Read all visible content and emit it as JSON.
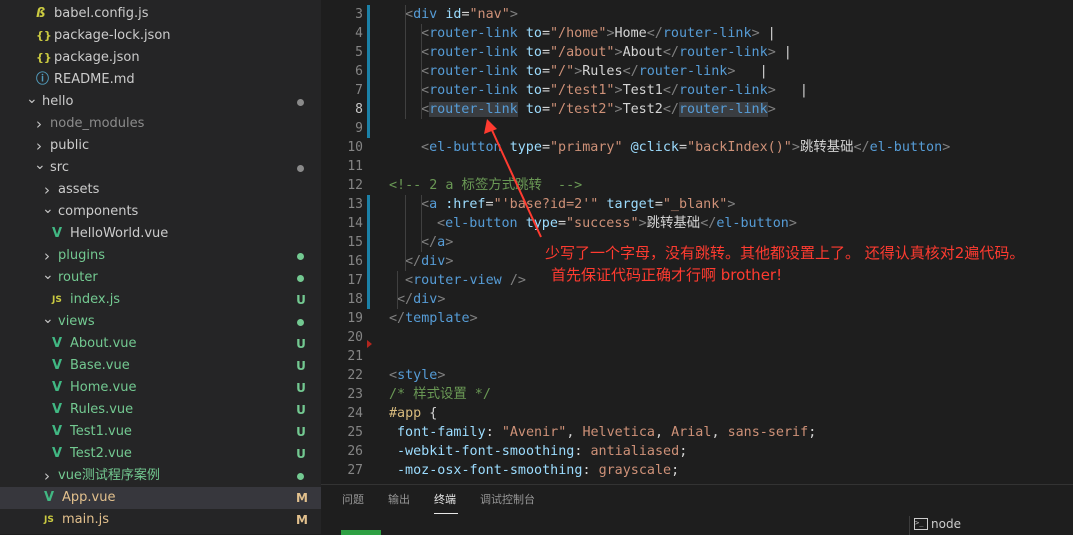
{
  "explorer": {
    "items": [
      {
        "label": "babel.config.js",
        "icon": "babel-file-icon",
        "icon_text": "",
        "depth": 1,
        "chevron": "",
        "color": "#cccccc",
        "status": "",
        "dot": ""
      },
      {
        "label": "package-lock.json",
        "icon": "json-file-icon",
        "icon_text": "{}",
        "depth": 1,
        "chevron": "",
        "color": "#cccccc",
        "status": "",
        "dot": ""
      },
      {
        "label": "package.json",
        "icon": "json-file-icon",
        "icon_text": "{}",
        "depth": 1,
        "chevron": "",
        "color": "#cccccc",
        "status": "",
        "dot": ""
      },
      {
        "label": "README.md",
        "icon": "info-file-icon",
        "icon_text": "ⓘ",
        "depth": 1,
        "chevron": "",
        "color": "#cccccc",
        "status": "",
        "dot": ""
      },
      {
        "label": "hello",
        "icon": "",
        "icon_text": "",
        "depth": 0,
        "chevron": "open",
        "color": "#cccccc",
        "status": "",
        "dot": "#8a8a8a"
      },
      {
        "label": "node_modules",
        "icon": "",
        "icon_text": "",
        "depth": 1,
        "chevron": "closed",
        "color": "#8c8c8c",
        "status": "",
        "dot": ""
      },
      {
        "label": "public",
        "icon": "",
        "icon_text": "",
        "depth": 1,
        "chevron": "closed",
        "color": "#cccccc",
        "status": "",
        "dot": ""
      },
      {
        "label": "src",
        "icon": "",
        "icon_text": "",
        "depth": 1,
        "chevron": "open",
        "color": "#cccccc",
        "status": "",
        "dot": "#8a8a8a"
      },
      {
        "label": "assets",
        "icon": "",
        "icon_text": "",
        "depth": 2,
        "chevron": "closed",
        "color": "#cccccc",
        "status": "",
        "dot": ""
      },
      {
        "label": "components",
        "icon": "",
        "icon_text": "",
        "depth": 2,
        "chevron": "open",
        "color": "#cccccc",
        "status": "",
        "dot": ""
      },
      {
        "label": "HelloWorld.vue",
        "icon": "vue-file-icon",
        "icon_text": "V",
        "depth": 3,
        "chevron": "",
        "color": "#cccccc",
        "status": "",
        "dot": ""
      },
      {
        "label": "plugins",
        "icon": "",
        "icon_text": "",
        "depth": 2,
        "chevron": "closed",
        "color": "#73c991",
        "status": "",
        "dot": "#73c991"
      },
      {
        "label": "router",
        "icon": "",
        "icon_text": "",
        "depth": 2,
        "chevron": "open",
        "color": "#73c991",
        "status": "",
        "dot": "#73c991"
      },
      {
        "label": "index.js",
        "icon": "js-file-icon",
        "icon_text": "JS",
        "depth": 3,
        "chevron": "",
        "color": "#73c991",
        "status": "U",
        "dot": ""
      },
      {
        "label": "views",
        "icon": "",
        "icon_text": "",
        "depth": 2,
        "chevron": "open",
        "color": "#73c991",
        "status": "",
        "dot": "#73c991"
      },
      {
        "label": "About.vue",
        "icon": "vue-file-icon",
        "icon_text": "V",
        "depth": 3,
        "chevron": "",
        "color": "#73c991",
        "status": "U",
        "dot": ""
      },
      {
        "label": "Base.vue",
        "icon": "vue-file-icon",
        "icon_text": "V",
        "depth": 3,
        "chevron": "",
        "color": "#73c991",
        "status": "U",
        "dot": ""
      },
      {
        "label": "Home.vue",
        "icon": "vue-file-icon",
        "icon_text": "V",
        "depth": 3,
        "chevron": "",
        "color": "#73c991",
        "status": "U",
        "dot": ""
      },
      {
        "label": "Rules.vue",
        "icon": "vue-file-icon",
        "icon_text": "V",
        "depth": 3,
        "chevron": "",
        "color": "#73c991",
        "status": "U",
        "dot": ""
      },
      {
        "label": "Test1.vue",
        "icon": "vue-file-icon",
        "icon_text": "V",
        "depth": 3,
        "chevron": "",
        "color": "#73c991",
        "status": "U",
        "dot": ""
      },
      {
        "label": "Test2.vue",
        "icon": "vue-file-icon",
        "icon_text": "V",
        "depth": 3,
        "chevron": "",
        "color": "#73c991",
        "status": "U",
        "dot": ""
      },
      {
        "label": "vue测试程序案例",
        "icon": "",
        "icon_text": "",
        "depth": 2,
        "chevron": "closed",
        "color": "#73c991",
        "status": "",
        "dot": "#73c991"
      },
      {
        "label": "App.vue",
        "icon": "vue-file-icon",
        "icon_text": "V",
        "depth": 2,
        "chevron": "",
        "color": "#e2c08d",
        "status": "M",
        "dot": "",
        "selected": true
      },
      {
        "label": "main.js",
        "icon": "js-file-icon",
        "icon_text": "JS",
        "depth": 2,
        "chevron": "",
        "color": "#e2c08d",
        "status": "M",
        "dot": ""
      }
    ]
  },
  "editor": {
    "current_line": 8,
    "lines": [
      {
        "n": 3,
        "indent": 1,
        "tokens": [
          [
            "punc",
            "<"
          ],
          [
            "tag",
            "div"
          ],
          [
            "txt",
            " "
          ],
          [
            "attr",
            "id"
          ],
          [
            "txt",
            "="
          ],
          [
            "str",
            "\"nav\""
          ],
          [
            "punc",
            ">"
          ]
        ]
      },
      {
        "n": 4,
        "indent": 2,
        "tokens": [
          [
            "punc",
            "<"
          ],
          [
            "tag",
            "router-link"
          ],
          [
            "txt",
            " "
          ],
          [
            "attr",
            "to"
          ],
          [
            "txt",
            "="
          ],
          [
            "str",
            "\"/home\""
          ],
          [
            "punc",
            ">"
          ],
          [
            "txt",
            "Home"
          ],
          [
            "punc",
            "</"
          ],
          [
            "tag",
            "router-link"
          ],
          [
            "punc",
            ">"
          ],
          [
            "txt",
            " |"
          ]
        ]
      },
      {
        "n": 5,
        "indent": 2,
        "tokens": [
          [
            "punc",
            "<"
          ],
          [
            "tag",
            "router-link"
          ],
          [
            "txt",
            " "
          ],
          [
            "attr",
            "to"
          ],
          [
            "txt",
            "="
          ],
          [
            "str",
            "\"/about\""
          ],
          [
            "punc",
            ">"
          ],
          [
            "txt",
            "About"
          ],
          [
            "punc",
            "</"
          ],
          [
            "tag",
            "router-link"
          ],
          [
            "punc",
            ">"
          ],
          [
            "txt",
            " |"
          ]
        ]
      },
      {
        "n": 6,
        "indent": 2,
        "tokens": [
          [
            "punc",
            "<"
          ],
          [
            "tag",
            "router-link"
          ],
          [
            "txt",
            " "
          ],
          [
            "attr",
            "to"
          ],
          [
            "txt",
            "="
          ],
          [
            "str",
            "\"/\""
          ],
          [
            "punc",
            ">"
          ],
          [
            "txt",
            "Rules"
          ],
          [
            "punc",
            "</"
          ],
          [
            "tag",
            "router-link"
          ],
          [
            "punc",
            ">"
          ],
          [
            "txt",
            "   |"
          ]
        ]
      },
      {
        "n": 7,
        "indent": 2,
        "tokens": [
          [
            "punc",
            "<"
          ],
          [
            "tag",
            "router-link"
          ],
          [
            "txt",
            " "
          ],
          [
            "attr",
            "to"
          ],
          [
            "txt",
            "="
          ],
          [
            "str",
            "\"/test1\""
          ],
          [
            "punc",
            ">"
          ],
          [
            "txt",
            "Test1"
          ],
          [
            "punc",
            "</"
          ],
          [
            "tag",
            "router-link"
          ],
          [
            "punc",
            ">"
          ],
          [
            "txt",
            "   |"
          ]
        ]
      },
      {
        "n": 8,
        "indent": 2,
        "tokens": [
          [
            "punc",
            "<"
          ],
          [
            "tag",
            "router-link"
          ],
          [
            "txt",
            " "
          ],
          [
            "attr",
            "to"
          ],
          [
            "txt",
            "="
          ],
          [
            "str",
            "\"/test2\""
          ],
          [
            "punc",
            ">"
          ],
          [
            "txt",
            "Test2"
          ],
          [
            "punc",
            "</"
          ],
          [
            "tag",
            "router-link"
          ],
          [
            "punc",
            ">"
          ]
        ]
      },
      {
        "n": 9,
        "indent": 0,
        "tokens": []
      },
      {
        "n": 10,
        "indent": 2,
        "tokens": [
          [
            "punc",
            "<"
          ],
          [
            "tag",
            "el-button"
          ],
          [
            "txt",
            " "
          ],
          [
            "attr",
            "type"
          ],
          [
            "txt",
            "="
          ],
          [
            "str",
            "\"primary\""
          ],
          [
            "txt",
            " "
          ],
          [
            "attr",
            "@click"
          ],
          [
            "txt",
            "="
          ],
          [
            "str",
            "\"backIndex()\""
          ],
          [
            "punc",
            ">"
          ],
          [
            "txt",
            "跳转基础"
          ],
          [
            "punc",
            "</"
          ],
          [
            "tag",
            "el-button"
          ],
          [
            "punc",
            ">"
          ]
        ]
      },
      {
        "n": 11,
        "indent": 0,
        "tokens": []
      },
      {
        "n": 12,
        "indent": 0,
        "tokens": [
          [
            "com",
            "<!-- 2 a 标签方式跳转  -->"
          ]
        ]
      },
      {
        "n": 13,
        "indent": 2,
        "tokens": [
          [
            "punc",
            "<"
          ],
          [
            "tag",
            "a"
          ],
          [
            "txt",
            " "
          ],
          [
            "attr",
            ":href"
          ],
          [
            "txt",
            "="
          ],
          [
            "str",
            "\"'base?id=2'\""
          ],
          [
            "txt",
            " "
          ],
          [
            "attr",
            "target"
          ],
          [
            "txt",
            "="
          ],
          [
            "str",
            "\"_blank\""
          ],
          [
            "punc",
            ">"
          ]
        ]
      },
      {
        "n": 14,
        "indent": 3,
        "tokens": [
          [
            "punc",
            "<"
          ],
          [
            "tag",
            "el-button"
          ],
          [
            "txt",
            " "
          ],
          [
            "attr",
            "type"
          ],
          [
            "txt",
            "="
          ],
          [
            "str",
            "\"success\""
          ],
          [
            "punc",
            ">"
          ],
          [
            "txt",
            "跳转基础"
          ],
          [
            "punc",
            "</"
          ],
          [
            "tag",
            "el-button"
          ],
          [
            "punc",
            ">"
          ]
        ]
      },
      {
        "n": 15,
        "indent": 2,
        "tokens": [
          [
            "punc",
            "</"
          ],
          [
            "tag",
            "a"
          ],
          [
            "punc",
            ">"
          ]
        ]
      },
      {
        "n": 16,
        "indent": 1,
        "tokens": [
          [
            "punc",
            "</"
          ],
          [
            "tag",
            "div"
          ],
          [
            "punc",
            ">"
          ]
        ]
      },
      {
        "n": 17,
        "indent": 1,
        "tokens": [
          [
            "punc",
            "<"
          ],
          [
            "tag",
            "router-view"
          ],
          [
            "txt",
            " "
          ],
          [
            "punc",
            "/>"
          ]
        ]
      },
      {
        "n": 18,
        "indent": 0.5,
        "tokens": [
          [
            "punc",
            "</"
          ],
          [
            "tag",
            "div"
          ],
          [
            "punc",
            ">"
          ]
        ]
      },
      {
        "n": 19,
        "indent": 0,
        "tokens": [
          [
            "punc",
            "</"
          ],
          [
            "tag",
            "template"
          ],
          [
            "punc",
            ">"
          ]
        ]
      },
      {
        "n": 20,
        "indent": 0,
        "tokens": []
      },
      {
        "n": 21,
        "indent": 0,
        "tokens": []
      },
      {
        "n": 22,
        "indent": 0,
        "tokens": [
          [
            "punc",
            "<"
          ],
          [
            "tag",
            "style"
          ],
          [
            "punc",
            ">"
          ]
        ]
      },
      {
        "n": 23,
        "indent": 0,
        "tokens": [
          [
            "com",
            "/* 样式设置 */"
          ]
        ]
      },
      {
        "n": 24,
        "indent": 0,
        "tokens": [
          [
            "sel",
            "#app"
          ],
          [
            "txt",
            " {"
          ]
        ]
      },
      {
        "n": 25,
        "indent": 0.5,
        "tokens": [
          [
            "prop",
            "font-family"
          ],
          [
            "txt",
            ": "
          ],
          [
            "val",
            "\"Avenir\""
          ],
          [
            "txt",
            ", "
          ],
          [
            "val",
            "Helvetica"
          ],
          [
            "txt",
            ", "
          ],
          [
            "val",
            "Arial"
          ],
          [
            "txt",
            ", "
          ],
          [
            "val",
            "sans-serif"
          ],
          [
            "txt",
            ";"
          ]
        ]
      },
      {
        "n": 26,
        "indent": 0.5,
        "tokens": [
          [
            "prop",
            "-webkit-font-smoothing"
          ],
          [
            "txt",
            ": "
          ],
          [
            "val",
            "antialiased"
          ],
          [
            "txt",
            ";"
          ]
        ]
      },
      {
        "n": 27,
        "indent": 0.5,
        "tokens": [
          [
            "prop",
            "-moz-osx-font-smoothing"
          ],
          [
            "txt",
            ": "
          ],
          [
            "val",
            "grayscale"
          ],
          [
            "txt",
            ";"
          ]
        ]
      }
    ],
    "annotation": {
      "line1": "少写了一个字母，没有跳转。其他都设置上了。 还得认真核对2遍代码。",
      "line2": "首先保证代码正确才行啊  brother!"
    }
  },
  "panel": {
    "tabs": [
      {
        "label": "问题",
        "active": false
      },
      {
        "label": "输出",
        "active": false
      },
      {
        "label": "终端",
        "active": true
      },
      {
        "label": "调试控制台",
        "active": false
      }
    ],
    "terminal_selector": "node"
  },
  "colors": {
    "sidebar_bg": "#252526",
    "editor_bg": "#1e1e1e",
    "untracked": "#73c991",
    "modified": "#e2c08d",
    "annotation": "#ff3b30"
  }
}
